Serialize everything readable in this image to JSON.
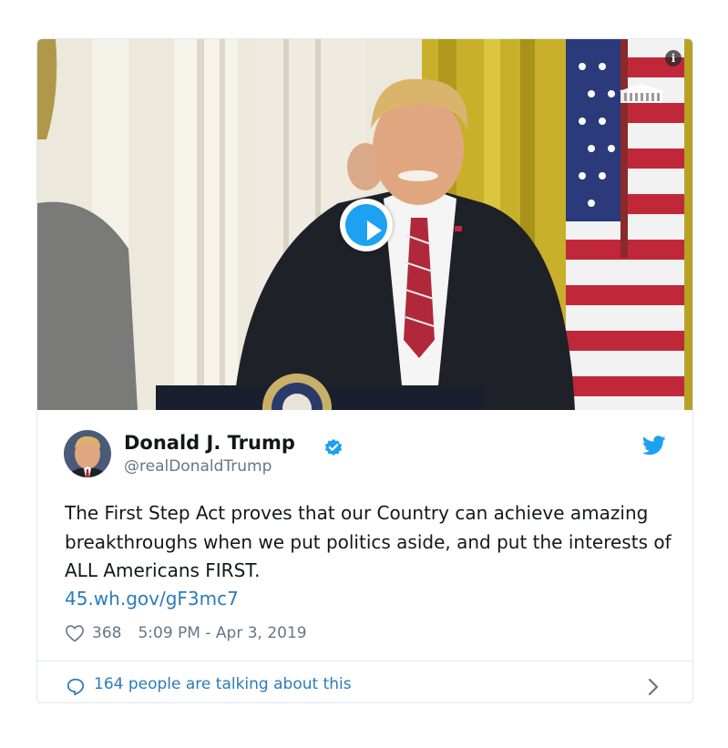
{
  "media": {
    "type": "video",
    "play_icon": "play-icon",
    "info_icon": "info-icon",
    "info_glyph": "i",
    "logo_icon": "white-house-logo-icon"
  },
  "tweet": {
    "display_name": "Donald J. Trump",
    "handle": "@realDonaldTrump",
    "verified_icon": "verified-badge-icon",
    "brand_icon": "twitter-bird-icon",
    "text": "The First Step Act proves that our Country can achieve amazing breakthroughs when we put politics aside, and put the interests of ALL Americans FIRST.",
    "link": "45.wh.gov/gF3mc7",
    "like_icon": "heart-icon",
    "like_count": "368",
    "timestamp": "5:09 PM - Apr 3, 2019"
  },
  "conversation": {
    "icon": "speech-bubble-icon",
    "label": "164 people are talking about this",
    "chevron_icon": "chevron-right-icon"
  },
  "colors": {
    "accent": "#1da1f2",
    "link": "#2b7bb9",
    "text": "#14171a",
    "secondary": "#657786",
    "border": "#e1e8ed"
  }
}
